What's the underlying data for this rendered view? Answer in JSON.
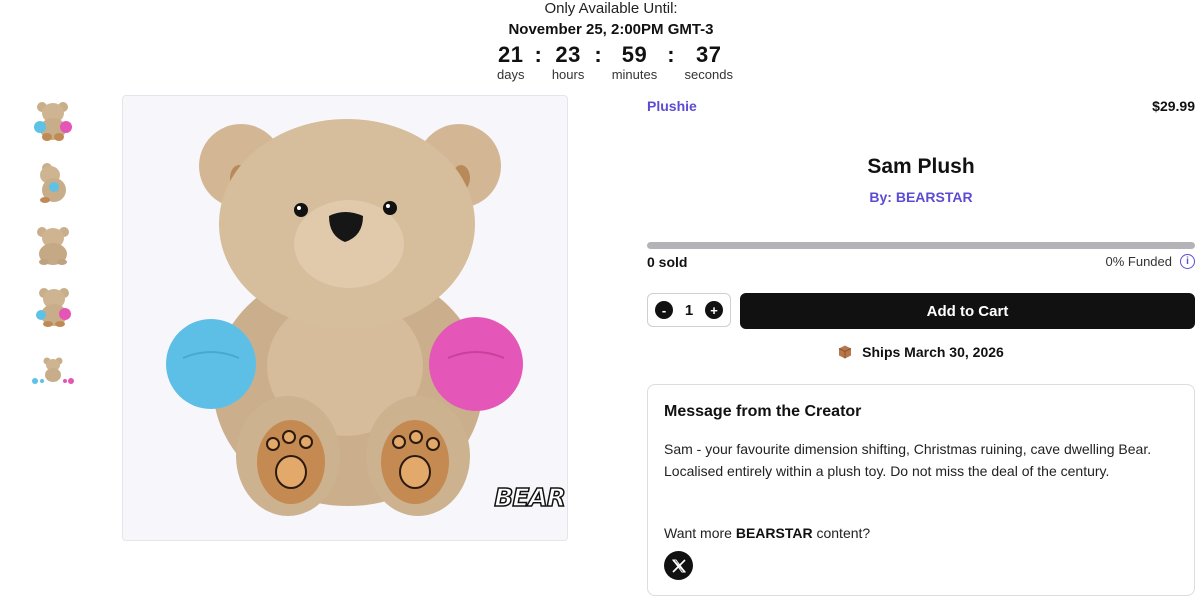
{
  "countdown": {
    "label": "Only Available Until:",
    "date": "November 25, 2:00PM GMT-3",
    "units": [
      {
        "value": "21",
        "label": "days"
      },
      {
        "value": "23",
        "label": "hours"
      },
      {
        "value": "59",
        "label": "minutes"
      },
      {
        "value": "37",
        "label": "seconds"
      }
    ],
    "separator": ":"
  },
  "gallery": {
    "thumbnails": [
      "front-with-balls",
      "side-view",
      "back-view",
      "angle-with-balls",
      "small-front"
    ],
    "brand_mark": "BEAR"
  },
  "product": {
    "category": "Plushie",
    "price": "$29.99",
    "title": "Sam Plush",
    "creator_line": "By: BEARSTAR",
    "sold": "0 sold",
    "funded": "0% Funded",
    "funded_fraction": 0,
    "quantity": "1",
    "qty_minus": "-",
    "qty_plus": "+",
    "add_to_cart": "Add to Cart",
    "ships": "Ships March 30, 2026"
  },
  "message": {
    "heading": "Message from the Creator",
    "body": "Sam - your favourite dimension shifting, Christmas ruining, cave dwelling Bear. Localised entirely within a plush toy. Do not miss the deal of the century.",
    "more_prefix": "Want more ",
    "more_brand": "BEARSTAR",
    "more_suffix": " content?"
  },
  "colors": {
    "accent": "#5c4cd3",
    "button": "#111111",
    "progress_track": "#b4b4b8"
  },
  "icons": [
    "info-icon",
    "box-icon",
    "x-logo-icon",
    "minus-icon",
    "plus-icon"
  ]
}
